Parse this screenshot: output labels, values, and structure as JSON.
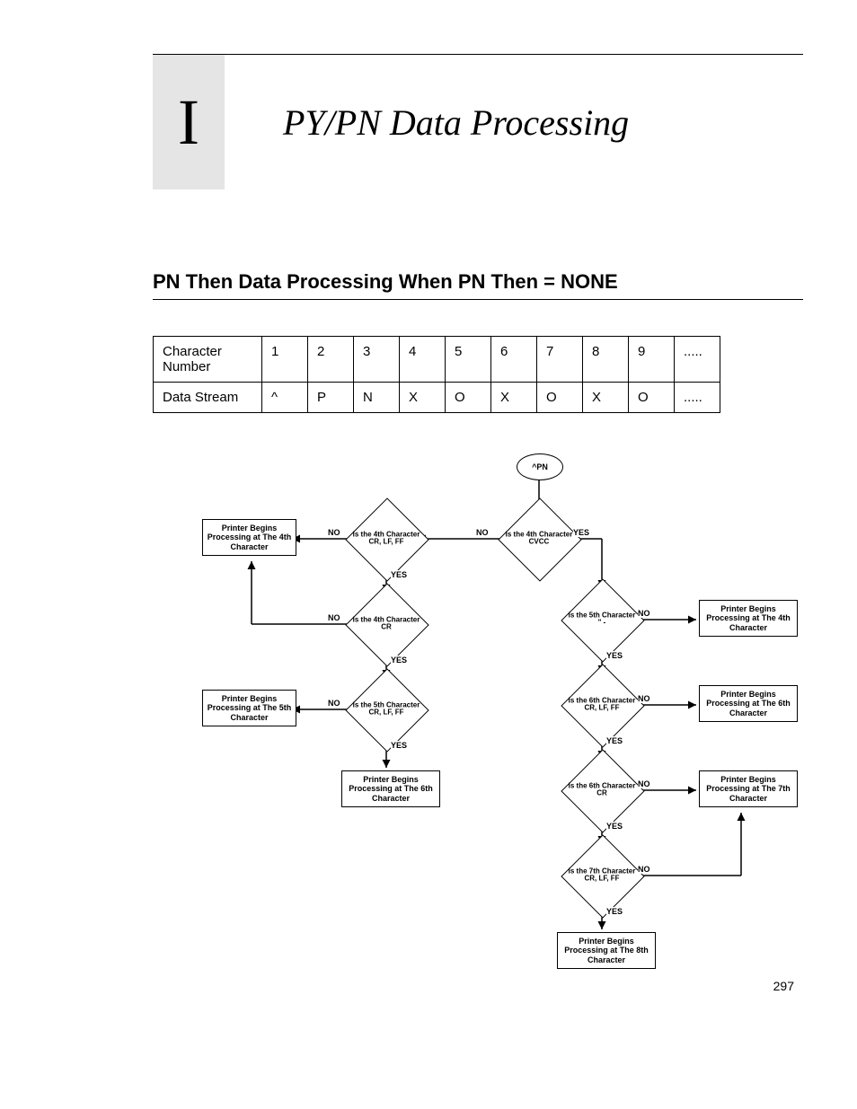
{
  "chapter_letter": "I",
  "chapter_title": "PY/PN Data Processing",
  "section_heading": "PN Then Data Processing When PN Then = NONE",
  "table": {
    "rows": [
      [
        "Character Number",
        "1",
        "2",
        "3",
        "4",
        "5",
        "6",
        "7",
        "8",
        "9",
        "....."
      ],
      [
        "Data Stream",
        "^",
        "P",
        "N",
        "X",
        "O",
        "X",
        "O",
        "X",
        "O",
        "....."
      ]
    ]
  },
  "flow": {
    "start": "^PN",
    "d_left_1": "Is the 4th Character CR, LF, FF",
    "d_left_2": "Is the 4th Character CR",
    "d_left_3": "Is the 5th Character CR, LF, FF",
    "d_right_1": "Is the 4th Character CVCC",
    "d_right_2": "Is the 5th Character \" -",
    "d_right_3": "Is the 6th Character CR, LF, FF",
    "d_right_4": "Is the 6th Character CR",
    "d_right_5": "Is the 7th Character CR, LF, FF",
    "box_4th": "Printer Begins Processing at The 4th Character",
    "box_5th": "Printer Begins Processing at The 5th Character",
    "box_6th": "Printer Begins Processing at The 6th Character",
    "box_7th": "Printer Begins Processing at The 7th Character",
    "box_8th": "Printer Begins Processing at The 8th Character",
    "yes": "YES",
    "no": "NO"
  },
  "page_number": "297"
}
